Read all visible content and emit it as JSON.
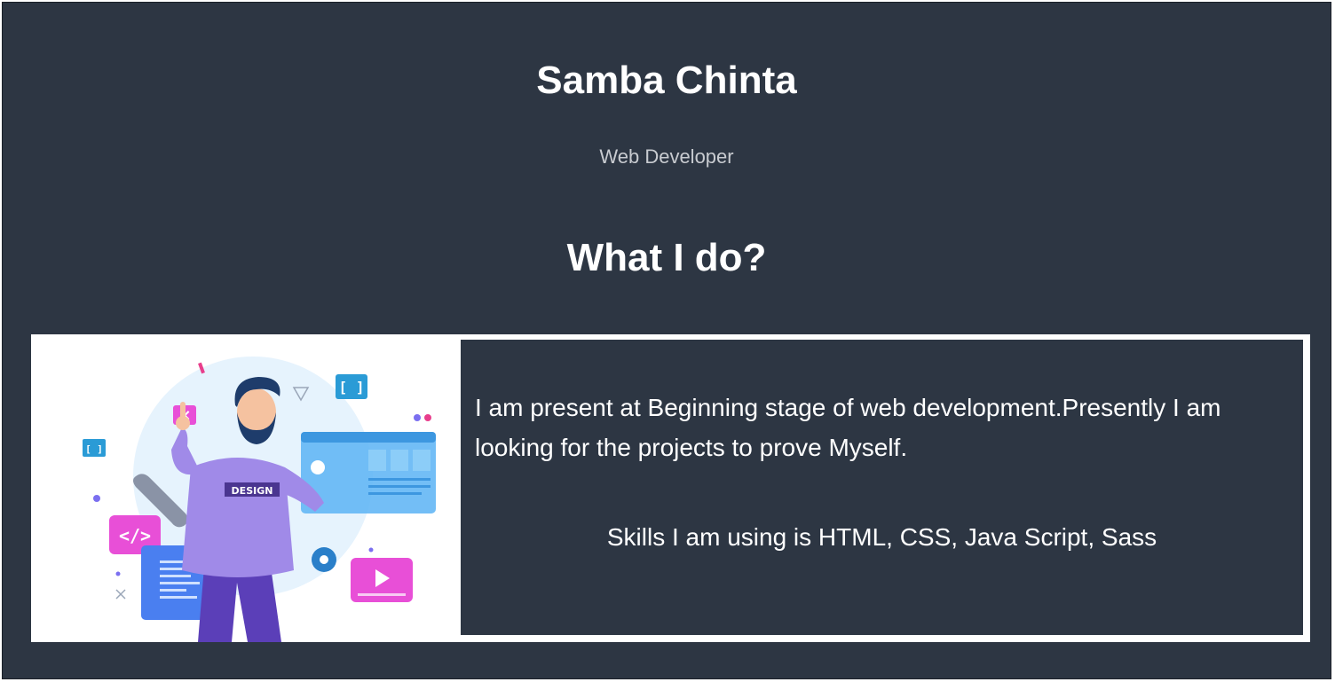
{
  "header": {
    "name": "Samba Chinta",
    "role": "Web Developer"
  },
  "about": {
    "title": "What I do?",
    "description": "I am present at Beginning stage of web development.Presently I am looking for the projects to prove Myself.",
    "skills": "Skills I am using is HTML, CSS, Java Script, Sass",
    "illustration": {
      "shirt_text": "DESIGN",
      "code_badge_text": "</>",
      "bracket_text": "[ ]",
      "close_text": "×"
    }
  },
  "colors": {
    "background": "#2d3643",
    "text": "#ffffff",
    "subtext": "#c8cbd0",
    "accent_purple": "#9b7bea",
    "accent_blue": "#5ab3f5",
    "accent_pink": "#e84fd7"
  }
}
